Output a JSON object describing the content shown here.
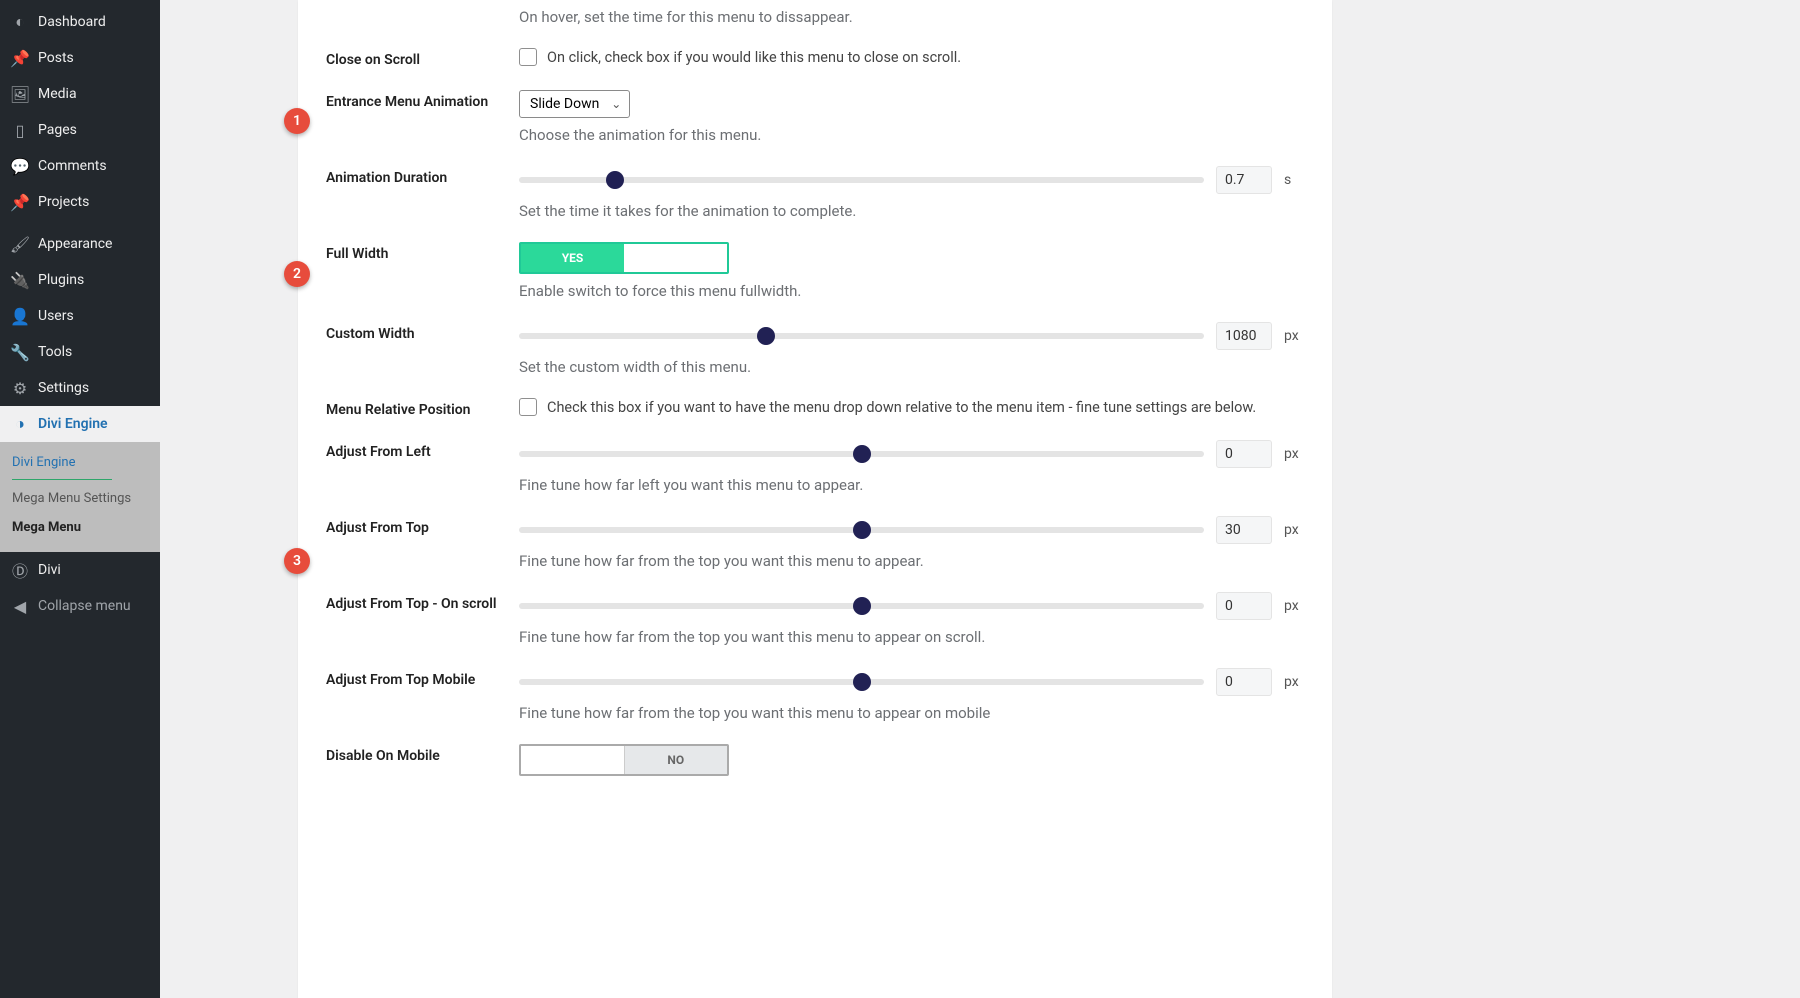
{
  "sidebar": {
    "items": [
      {
        "label": "Dashboard"
      },
      {
        "label": "Posts"
      },
      {
        "label": "Media"
      },
      {
        "label": "Pages"
      },
      {
        "label": "Comments"
      },
      {
        "label": "Projects"
      },
      {
        "label": "Appearance"
      },
      {
        "label": "Plugins"
      },
      {
        "label": "Users"
      },
      {
        "label": "Tools"
      },
      {
        "label": "Settings"
      },
      {
        "label": "Divi Engine"
      }
    ],
    "submenu_selected": {
      "head": "Divi Engine",
      "items": [
        "Mega Menu Settings",
        "Mega Menu"
      ]
    },
    "after": [
      {
        "label": "Divi"
      },
      {
        "label": "Collapse menu"
      }
    ]
  },
  "settings": {
    "hover_time_desc": "On hover, set the time for this menu to dissappear.",
    "close_on_scroll": {
      "label": "Close on Scroll",
      "text": "On click, check box if you would like this menu to close on scroll."
    },
    "entrance_animation": {
      "label": "Entrance Menu Animation",
      "value": "Slide Down",
      "desc": "Choose the animation for this menu."
    },
    "animation_duration": {
      "label": "Animation Duration",
      "value": "0.7",
      "unit": "s",
      "desc": "Set the time it takes for the animation to complete.",
      "thumb_pct": 14
    },
    "full_width": {
      "label": "Full Width",
      "yes": "YES",
      "desc": "Enable switch to force this menu fullwidth."
    },
    "custom_width": {
      "label": "Custom Width",
      "value": "1080",
      "unit": "px",
      "desc": "Set the custom width of this menu.",
      "thumb_pct": 36
    },
    "menu_relative": {
      "label": "Menu Relative Position",
      "text": "Check this box if you want to have the menu drop down relative to the menu item - fine tune settings are below."
    },
    "adjust_left": {
      "label": "Adjust From Left",
      "value": "0",
      "unit": "px",
      "desc": "Fine tune how far left you want this menu to appear.",
      "thumb_pct": 50
    },
    "adjust_top": {
      "label": "Adjust From Top",
      "value": "30",
      "unit": "px",
      "desc": "Fine tune how far from the top you want this menu to appear.",
      "thumb_pct": 50
    },
    "adjust_top_scroll": {
      "label": "Adjust From Top - On scroll",
      "value": "0",
      "unit": "px",
      "desc": "Fine tune how far from the top you want this menu to appear on scroll.",
      "thumb_pct": 50
    },
    "adjust_top_mobile": {
      "label": "Adjust From Top Mobile",
      "value": "0",
      "unit": "px",
      "desc": "Fine tune how far from the top you want this menu to appear on mobile",
      "thumb_pct": 50
    },
    "disable_mobile": {
      "label": "Disable On Mobile",
      "no": "NO"
    }
  },
  "annotations": [
    "1",
    "2",
    "3"
  ]
}
